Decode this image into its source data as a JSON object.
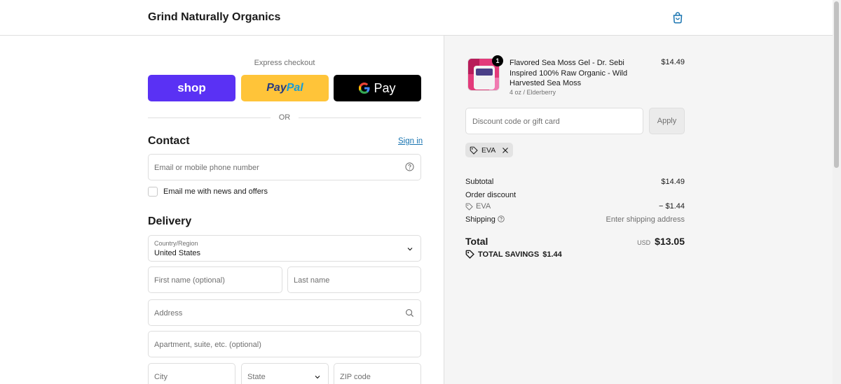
{
  "header": {
    "store_name": "Grind Naturally Organics",
    "cart_icon": "shopping-bag-icon"
  },
  "express": {
    "title": "Express checkout",
    "shop_label": "shop",
    "paypal_part1": "Pay",
    "paypal_part2": "Pal",
    "gpay_label": "Pay",
    "or_text": "OR"
  },
  "contact": {
    "title": "Contact",
    "sign_in": "Sign in",
    "email_placeholder": "Email or mobile phone number",
    "newsletter_label": "Email me with news and offers"
  },
  "delivery": {
    "title": "Delivery",
    "country_label": "Country/Region",
    "country_value": "United States",
    "first_name_placeholder": "First name (optional)",
    "last_name_placeholder": "Last name",
    "address_placeholder": "Address",
    "apartment_placeholder": "Apartment, suite, etc. (optional)",
    "city_placeholder": "City",
    "state_placeholder": "State",
    "zip_placeholder": "ZIP code"
  },
  "order": {
    "item": {
      "quantity": "1",
      "name": "Flavored Sea Moss Gel - Dr. Sebi Inspired 100% Raw Organic - Wild Harvested Sea Moss",
      "variant": "4 oz / Elderberry",
      "price": "$14.49"
    },
    "discount_placeholder": "Discount code or gift card",
    "apply_label": "Apply",
    "applied_code": "EVA",
    "subtotal_label": "Subtotal",
    "subtotal_value": "$14.49",
    "order_discount_label": "Order discount",
    "discount_code": "EVA",
    "discount_value": "− $1.44",
    "shipping_label": "Shipping",
    "shipping_value": "Enter shipping address",
    "total_label": "Total",
    "currency": "USD",
    "total_value": "$13.05",
    "savings_label": "TOTAL SAVINGS",
    "savings_value": "$1.44"
  },
  "colors": {
    "shop_purple": "#5a31f4",
    "paypal_yellow": "#ffc439",
    "link_blue": "#1773b0",
    "panel_bg": "#f5f5f5"
  }
}
